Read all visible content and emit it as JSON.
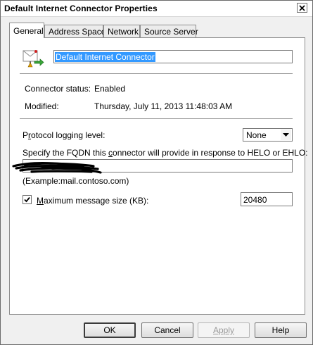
{
  "window": {
    "title": "Default Internet Connector Properties"
  },
  "tabs": [
    {
      "label": "General",
      "active": true
    },
    {
      "label": "Address Space",
      "active": false
    },
    {
      "label": "Network",
      "active": false
    },
    {
      "label": "Source Server",
      "active": false
    }
  ],
  "general": {
    "connector_name": "Default Internet Connector",
    "status_label": "Connector status:",
    "status_value": "Enabled",
    "modified_label": "Modified:",
    "modified_value": "Thursday, July 11, 2013 11:48:03 AM",
    "protocol_logging": {
      "label_prefix": "P",
      "label_underlined": "r",
      "label_suffix": "otocol logging level:",
      "selected": "None"
    },
    "fqdn": {
      "label_prefix": "Specify the FQDN this ",
      "label_underlined": "c",
      "label_suffix": "onnector will provide in response to HELO or EHLO:",
      "value": "",
      "example": "(Example:mail.contoso.com)"
    },
    "max_size": {
      "checked": true,
      "label_prefix": "",
      "label_underlined": "M",
      "label_suffix": "aximum message size (KB):",
      "value": "20480"
    }
  },
  "buttons": {
    "ok": "OK",
    "cancel": "Cancel",
    "apply": "Apply",
    "help": "Help"
  },
  "icons": {
    "connector": "send-connector-icon",
    "close": "close-icon",
    "dropdown": "chevron-down-icon",
    "check": "check-icon"
  }
}
